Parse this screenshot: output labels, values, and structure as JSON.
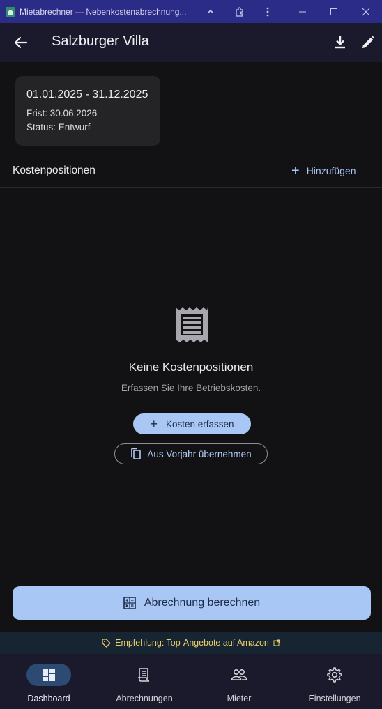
{
  "window": {
    "title": "Mietabrechner — Nebenkostenabrechnung...",
    "controls": [
      "chevron-up-icon",
      "extension-icon",
      "more-vert-icon",
      "minimize-icon",
      "maximize-icon",
      "close-icon"
    ]
  },
  "appbar": {
    "title": "Salzburger Villa",
    "actions": [
      "download-icon",
      "edit-icon"
    ]
  },
  "period_card": {
    "period": "01.01.2025 - 31.12.2025",
    "deadline": "Frist: 30.06.2026",
    "status": "Status: Entwurf"
  },
  "costs_section": {
    "heading": "Kostenpositionen",
    "add_label": "Hinzufügen"
  },
  "empty_state": {
    "icon": "receipt-icon",
    "title": "Keine Kostenpositionen",
    "subtitle": "Erfassen Sie Ihre Betriebskosten.",
    "primary_label": "Kosten erfassen",
    "secondary_label": "Aus Vorjahr übernehmen"
  },
  "calculate_button": {
    "label": "Abrechnung berechnen",
    "icon": "calculator-icon"
  },
  "promo": {
    "text": "Empfehlung: Top-Angebote auf Amazon"
  },
  "nav": {
    "items": [
      {
        "label": "Dashboard",
        "icon": "dashboard-icon",
        "active": true
      },
      {
        "label": "Abrechnungen",
        "icon": "receipt-icon",
        "active": false
      },
      {
        "label": "Mieter",
        "icon": "people-icon",
        "active": false
      },
      {
        "label": "Einstellungen",
        "icon": "gear-icon",
        "active": false
      }
    ]
  },
  "colors": {
    "background": "#121214",
    "appbar": "#1a1a2c",
    "titlebar": "#2b2b88",
    "accent": "#a9c7f5",
    "promo_text": "#e9cf6b",
    "active_pill": "#2c4a72"
  }
}
